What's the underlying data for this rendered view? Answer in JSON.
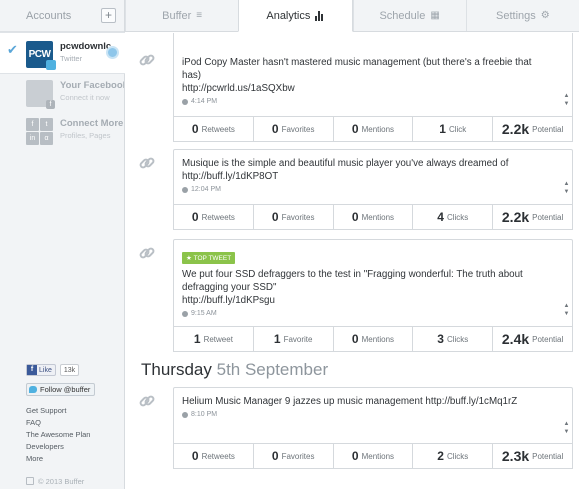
{
  "sidebar": {
    "accounts_label": "Accounts",
    "add_label": "+",
    "accounts": [
      {
        "name": "pcwdownlc",
        "sub": "Twitter",
        "avatar_text": "PCW"
      },
      {
        "name": "Your Facebook",
        "sub": "Connect it now"
      },
      {
        "name": "Connect More",
        "sub": "Profiles, Pages"
      }
    ],
    "like_label": "Like",
    "like_count": "13k",
    "follow_label": "Follow @buffer",
    "links": [
      "Get Support",
      "FAQ",
      "The Awesome Plan",
      "Developers",
      "More"
    ],
    "copyright": "© 2013 Buffer"
  },
  "tabs": [
    {
      "label": "Buffer",
      "icon": "stack-icon"
    },
    {
      "label": "Analytics",
      "icon": "bar-chart-icon"
    },
    {
      "label": "Schedule",
      "icon": "calendar-icon"
    },
    {
      "label": "Settings",
      "icon": "gear-icon"
    }
  ],
  "posts": [
    {
      "text": "iPod Copy Master hasn't mastered music management (but there's a freebie that has)",
      "link": "http://pcwrld.us/1aSQXbw",
      "time": "4:14 PM",
      "stats": [
        {
          "num": "0",
          "label": "Retweets"
        },
        {
          "num": "0",
          "label": "Favorites"
        },
        {
          "num": "0",
          "label": "Mentions"
        },
        {
          "num": "1",
          "label": "Click"
        },
        {
          "num": "2.2k",
          "label": "Potential"
        }
      ]
    },
    {
      "text": "Musique is the simple and beautiful music player you've always dreamed of",
      "link": "http://buff.ly/1dKP8OT",
      "time": "12:04 PM",
      "stats": [
        {
          "num": "0",
          "label": "Retweets"
        },
        {
          "num": "0",
          "label": "Favorites"
        },
        {
          "num": "0",
          "label": "Mentions"
        },
        {
          "num": "4",
          "label": "Clicks"
        },
        {
          "num": "2.2k",
          "label": "Potential"
        }
      ]
    },
    {
      "tag": "TOP TWEET",
      "text": "We put four SSD defraggers to the test in \"Fragging wonderful: The truth about defragging your SSD\"",
      "link": "http://buff.ly/1dKPsgu",
      "time": "9:15 AM",
      "stats": [
        {
          "num": "1",
          "label": "Retweet"
        },
        {
          "num": "1",
          "label": "Favorite"
        },
        {
          "num": "0",
          "label": "Mentions"
        },
        {
          "num": "3",
          "label": "Clicks"
        },
        {
          "num": "2.4k",
          "label": "Potential"
        }
      ]
    },
    {
      "text": "Helium Music Manager 9 jazzes up music management",
      "link": "http://buff.ly/1cMq1rZ",
      "time": "8:10 PM",
      "stats": [
        {
          "num": "0",
          "label": "Retweets"
        },
        {
          "num": "0",
          "label": "Favorites"
        },
        {
          "num": "0",
          "label": "Mentions"
        },
        {
          "num": "2",
          "label": "Clicks"
        },
        {
          "num": "2.3k",
          "label": "Potential"
        }
      ]
    }
  ],
  "day_heading": {
    "day": "Thursday",
    "date": "5th September"
  }
}
